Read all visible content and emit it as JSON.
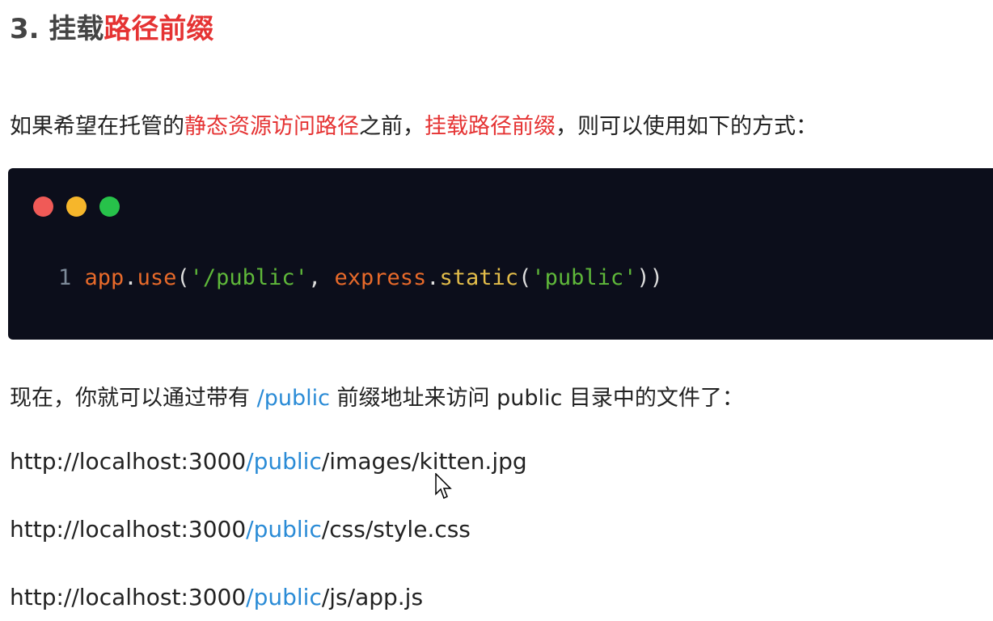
{
  "heading": {
    "prefix": "3. 挂载",
    "highlight": "路径前缀"
  },
  "intro": {
    "p1": "如果希望在托管的",
    "h1": "静态资源访问路径",
    "p2": "之前，",
    "h2": "挂载路径前缀",
    "p3": "，则可以使用如下的方式："
  },
  "code": {
    "line_number": "1",
    "app": "app",
    "dot1": ".",
    "use": "use",
    "open1": "(",
    "arg1": "'/public'",
    "comma": ", ",
    "express": "express",
    "dot2": ".",
    "static": "static",
    "open2": "(",
    "arg2": "'public'",
    "close": "))",
    "dots": [
      "#f05a57",
      "#f6b62b",
      "#27c24a"
    ]
  },
  "now": {
    "p1": "现在，你就可以通过带有 ",
    "h": "/public",
    "p2": " 前缀地址来访问 public 目录中的文件了："
  },
  "urls": [
    {
      "pre": "http://localhost:3000",
      "mid": "/public",
      "post": "/images/kitten.jpg"
    },
    {
      "pre": "http://localhost:3000",
      "mid": "/public",
      "post": "/css/style.css"
    },
    {
      "pre": "http://localhost:3000",
      "mid": "/public",
      "post": "/js/app.js"
    }
  ],
  "icons": {
    "cursor": "mouse-pointer-icon"
  }
}
